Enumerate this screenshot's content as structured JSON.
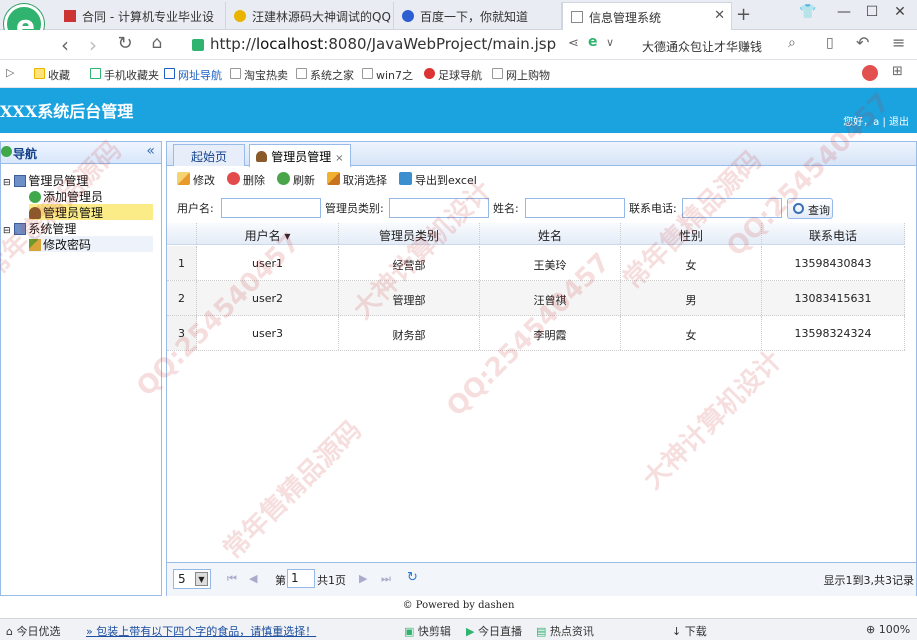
{
  "browser": {
    "tabs": [
      {
        "label": "合同 - 计算机专业毕业设"
      },
      {
        "label": "汪建林源码大神调试的QQ"
      },
      {
        "label": "百度一下，你就知道"
      },
      {
        "label": "信息管理系统",
        "active": true
      }
    ],
    "new_tab": "+",
    "url_prefix": "http://",
    "url_host": "localhost",
    "url_rest": ":8080/JavaWebProject/main.jsp",
    "search_suggestion": "大德通众包让才华赚钱",
    "bookmarks": [
      "收藏",
      "手机收藏夹",
      "网址导航",
      "淘宝热卖",
      "系统之家",
      "win7之",
      "足球导航",
      "网上购物"
    ]
  },
  "app": {
    "title": "XXX系统后台管理",
    "welcome": "您好，a | 退出"
  },
  "nav": {
    "title": "导航",
    "collapse": "«",
    "groups": [
      {
        "label": "管理员管理",
        "items": [
          "添加管理员",
          "管理员管理"
        ]
      },
      {
        "label": "系统管理",
        "items": [
          "修改密码"
        ]
      }
    ]
  },
  "tabs": {
    "home": "起始页",
    "current": "管理员管理",
    "close": "×"
  },
  "toolbar": {
    "edit": "修改",
    "delete": "删除",
    "refresh": "刷新",
    "unselect": "取消选择",
    "export": "导出到excel"
  },
  "search": {
    "username_label": "用户名:",
    "type_label": "管理员类别:",
    "name_label": "姓名:",
    "phone_label": "联系电话:",
    "query": "查询"
  },
  "grid": {
    "headers": [
      "用户名 ▾",
      "管理员类别",
      "姓名",
      "性别",
      "联系电话"
    ],
    "rows": [
      {
        "num": "1",
        "cells": [
          "user1",
          "经营部",
          "王美玲",
          "女",
          "13598430843"
        ]
      },
      {
        "num": "2",
        "cells": [
          "user2",
          "管理部",
          "汪曾祺",
          "男",
          "13083415631"
        ]
      },
      {
        "num": "3",
        "cells": [
          "user3",
          "财务部",
          "李明霞",
          "女",
          "13598324324"
        ]
      }
    ]
  },
  "pager": {
    "page_size": "5",
    "page_label": "第",
    "page_value": "1",
    "total_pages": "共1页",
    "summary": "显示1到3,共3记录"
  },
  "footer": "© Powered by dashen",
  "statusbar": {
    "left": "今日优选",
    "news": "包装上带有以下四个字的食品，请慎重选择！",
    "items": [
      "快剪辑",
      "今日直播",
      "热点资讯"
    ],
    "download": "下载",
    "zoom": "100%"
  },
  "watermark": [
    "常年售精品源码",
    "QQ:254540457",
    "大神计算机设计"
  ],
  "colors": {
    "header": "#1aa3df",
    "border": "#99bbe8",
    "selected": "#fbec88"
  }
}
